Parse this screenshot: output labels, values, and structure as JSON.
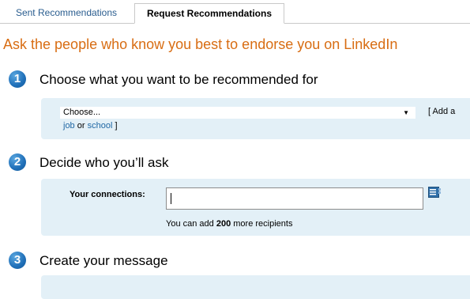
{
  "tabs": {
    "sent": "Sent Recommendations",
    "request": "Request Recommendations"
  },
  "headline": "Ask the people who know you best to endorse you on LinkedIn",
  "step1": {
    "number": "1",
    "title": "Choose what you want to be recommended for",
    "select_value": "Choose...",
    "add_prefix": "[ Add a",
    "add_job": "job",
    "add_or": "or",
    "add_school": "school",
    "add_suffix": "]"
  },
  "step2": {
    "number": "2",
    "title": "Decide who you’ll ask",
    "connections_label": "Your connections:",
    "connections_value": "",
    "recipients_prefix": "You can add",
    "recipients_count": "200",
    "recipients_suffix": "more recipients"
  },
  "step3": {
    "number": "3",
    "title": "Create your message"
  },
  "colors": {
    "headline": "#d86d13",
    "link": "#1f67a4",
    "panel": "#e3f0f7",
    "step_badge": "#1f6fb8"
  },
  "icons": {
    "addressbook": "addressbook-icon"
  }
}
